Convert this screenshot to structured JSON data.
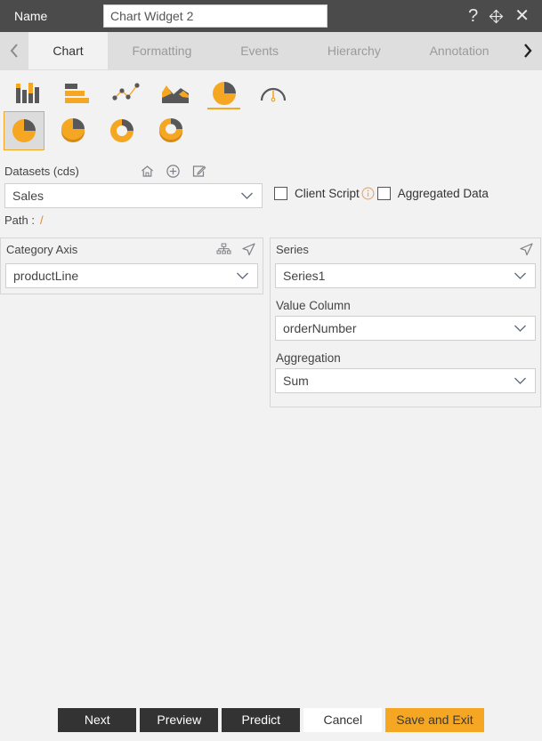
{
  "titlebar": {
    "name_label": "Name",
    "name_value": "Chart Widget 2",
    "name_placeholder": "Chart Widget 2",
    "help_glyph": "?",
    "close_glyph": "✕"
  },
  "tabs": {
    "prev_glyph": "‹",
    "next_glyph": "›",
    "items": [
      {
        "label": "Chart",
        "active": true
      },
      {
        "label": "Formatting",
        "active": false
      },
      {
        "label": "Events",
        "active": false
      },
      {
        "label": "Hierarchy",
        "active": false
      },
      {
        "label": "Annotation",
        "active": false
      }
    ]
  },
  "chart_types": {
    "row1": [
      {
        "name": "bar-chart-icon",
        "label": "Bar Chart"
      },
      {
        "name": "horizontal-bar-chart-icon",
        "label": "Horizontal Bar Chart"
      },
      {
        "name": "scatter-line-chart-icon",
        "label": "Scatter Line Chart"
      },
      {
        "name": "area-chart-icon",
        "label": "Area Chart"
      },
      {
        "name": "pie-chart-icon",
        "label": "Pie Chart"
      },
      {
        "name": "gauge-chart-icon",
        "label": "Gauge Chart"
      }
    ],
    "row2": [
      {
        "name": "pie-plain-icon",
        "label": "Pie"
      },
      {
        "name": "pie-3d-icon",
        "label": "Pie 3D"
      },
      {
        "name": "donut-icon",
        "label": "Donut"
      },
      {
        "name": "donut-3d-icon",
        "label": "Donut 3D"
      }
    ],
    "selected_row1_index": 4,
    "selected_row2_index": 0
  },
  "datasets": {
    "title": "Datasets (cds)",
    "icons": [
      {
        "name": "home-icon"
      },
      {
        "name": "add-circle-icon"
      },
      {
        "name": "edit-icon"
      }
    ],
    "value": "Sales",
    "path_label": "Path :",
    "path_value": "/",
    "client_script": {
      "label": "Client Script",
      "checked": false
    },
    "aggregated_data": {
      "label": "Aggregated Data",
      "checked": false
    }
  },
  "category_axis": {
    "title": "Category Axis",
    "value": "productLine"
  },
  "series": {
    "title": "Series",
    "value": "Series1",
    "value_column_label": "Value Column",
    "value_column": "orderNumber",
    "aggregation_label": "Aggregation",
    "aggregation": "Sum"
  },
  "footer": {
    "buttons": [
      {
        "label": "Next",
        "style": "dark"
      },
      {
        "label": "Preview",
        "style": "dark"
      },
      {
        "label": "Predict",
        "style": "dark"
      },
      {
        "label": "Cancel",
        "style": "light"
      },
      {
        "label": "Save and Exit",
        "style": "accent"
      }
    ]
  },
  "colors": {
    "accent": "#f5a623",
    "titlebar_bg": "#4b4b4b",
    "tabbar_bg": "#dedede",
    "page_bg": "#f2f2f2",
    "dark_button": "#333333",
    "icon_gray": "#58585a"
  }
}
